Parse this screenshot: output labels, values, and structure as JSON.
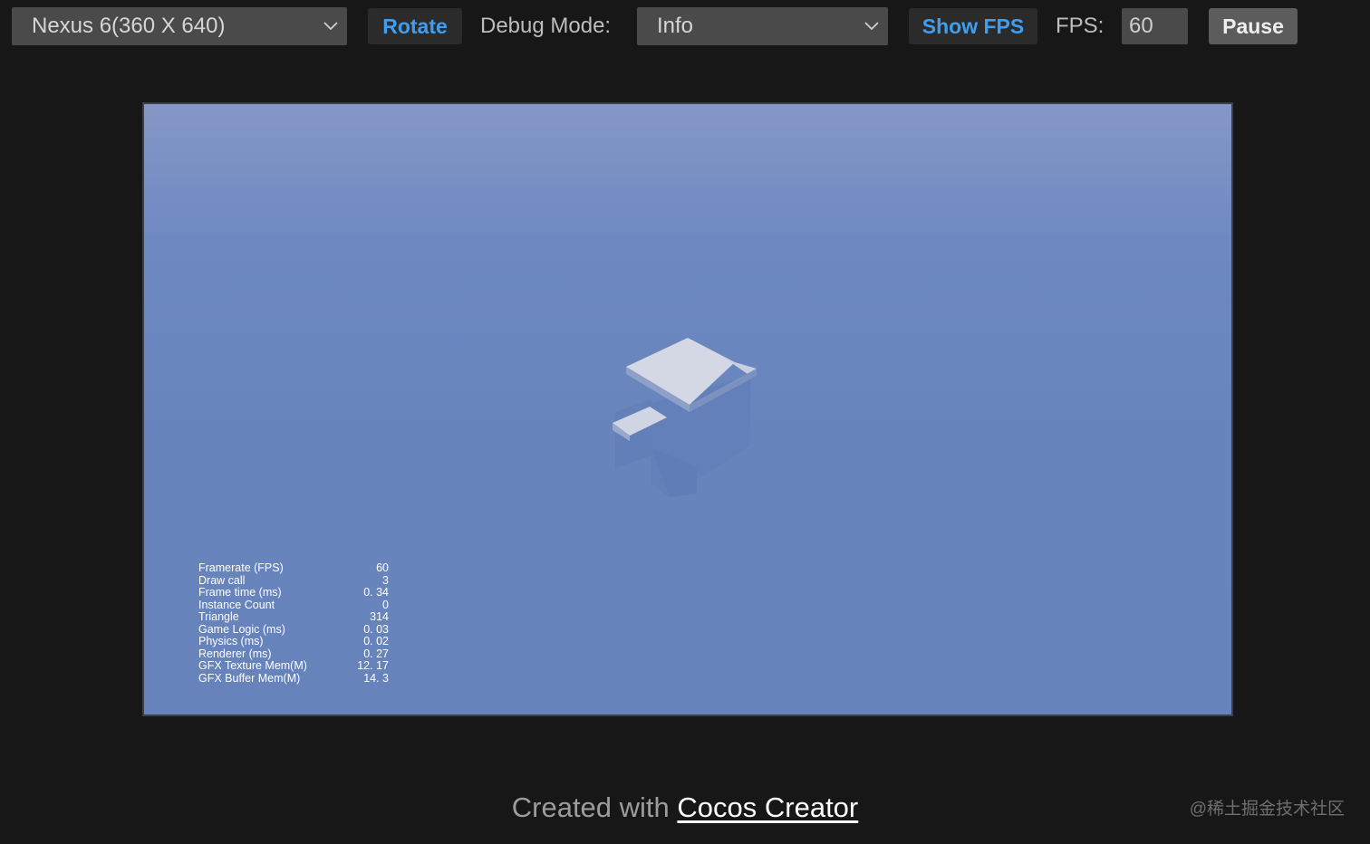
{
  "toolbar": {
    "device_select": {
      "value": "Nexus 6(360 X 640)",
      "icon": "chevron-down-icon"
    },
    "rotate_label": "Rotate",
    "debug_mode_label": "Debug Mode:",
    "debug_select": {
      "value": "Info",
      "icon": "chevron-down-icon"
    },
    "show_fps_label": "Show FPS",
    "fps_label": "FPS:",
    "fps_value": "60",
    "pause_label": "Pause"
  },
  "stats": [
    {
      "label": "Framerate (FPS)",
      "value": "60"
    },
    {
      "label": "Draw call",
      "value": "3"
    },
    {
      "label": "Frame time (ms)",
      "value": "0. 34"
    },
    {
      "label": "Instance Count",
      "value": "0"
    },
    {
      "label": "Triangle",
      "value": "314"
    },
    {
      "label": "Game Logic (ms)",
      "value": "0. 03"
    },
    {
      "label": "Physics (ms)",
      "value": "0. 02"
    },
    {
      "label": "Renderer (ms)",
      "value": "0. 27"
    },
    {
      "label": "GFX Texture Mem(M)",
      "value": "12. 17"
    },
    {
      "label": "GFX Buffer Mem(M)",
      "value": "14. 3"
    }
  ],
  "footer": {
    "prefix": "Created with ",
    "link_text": "Cocos Creator"
  },
  "watermark": "@稀土掘金技术社区",
  "colors": {
    "accent": "#3e9ff2",
    "background": "#171717",
    "canvas_sky": "#6784bd",
    "block_top": "#d4d8e4"
  }
}
